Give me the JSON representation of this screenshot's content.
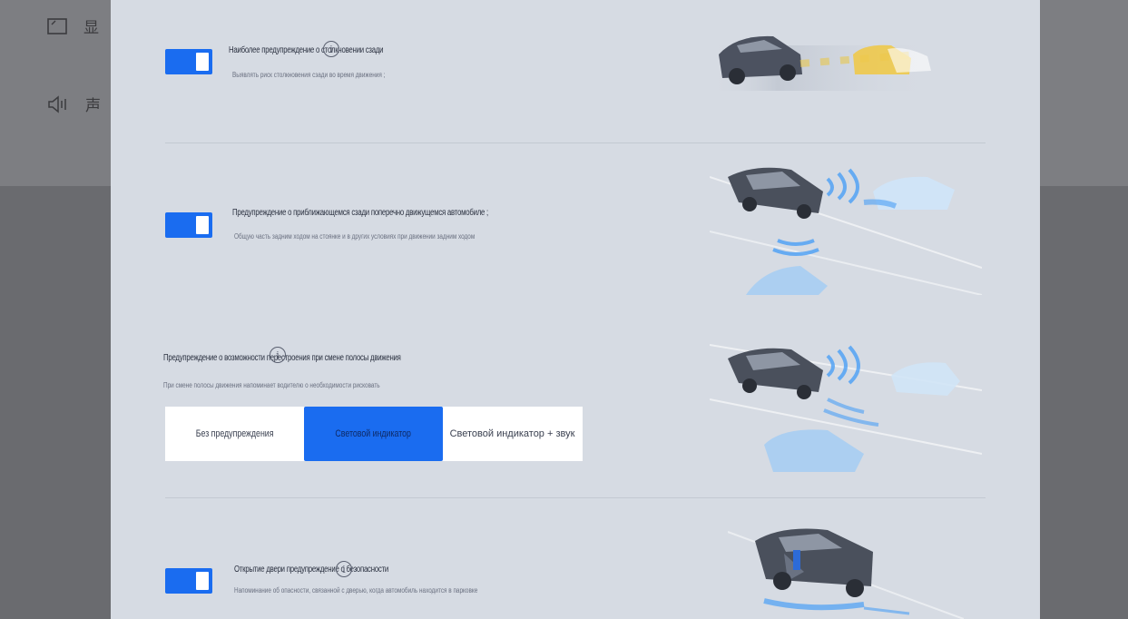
{
  "background": {
    "items": [
      {
        "label": "显",
        "icon": "display-icon"
      },
      {
        "label": "声",
        "icon": "speaker-icon"
      }
    ]
  },
  "sections": [
    {
      "title": "Наиболее предупреждение о столкновении сзади",
      "subtitle": "Выявлять риск столкновения сзади во время движения ;",
      "toggle": "on",
      "info": "i"
    },
    {
      "title": "Предупреждение о приближающемся сзади поперечно движущемся автомобиле ;",
      "subtitle": "Общую часть задним ходом на стоянке и в других условиях при движении задним ходом",
      "toggle": "on"
    },
    {
      "title": "Предупреждение о возможности перестроения при смене полосы движения",
      "subtitle": "При смене полосы движения напоминает водителю о необходимости рисковать",
      "info": "i",
      "options": [
        "Без предупреждения",
        "Световой индикатор",
        "Световой индикатор + звук"
      ],
      "selected_index": 1
    },
    {
      "title": "Открытие двери предупреждение о безопасности",
      "subtitle": "Напоминание об опасности, связанной с дверью, когда автомобиль находится в парковке",
      "toggle": "on",
      "info": "i"
    }
  ],
  "colors": {
    "accent": "#1a6cf0",
    "panel": "#d6dbe3"
  }
}
